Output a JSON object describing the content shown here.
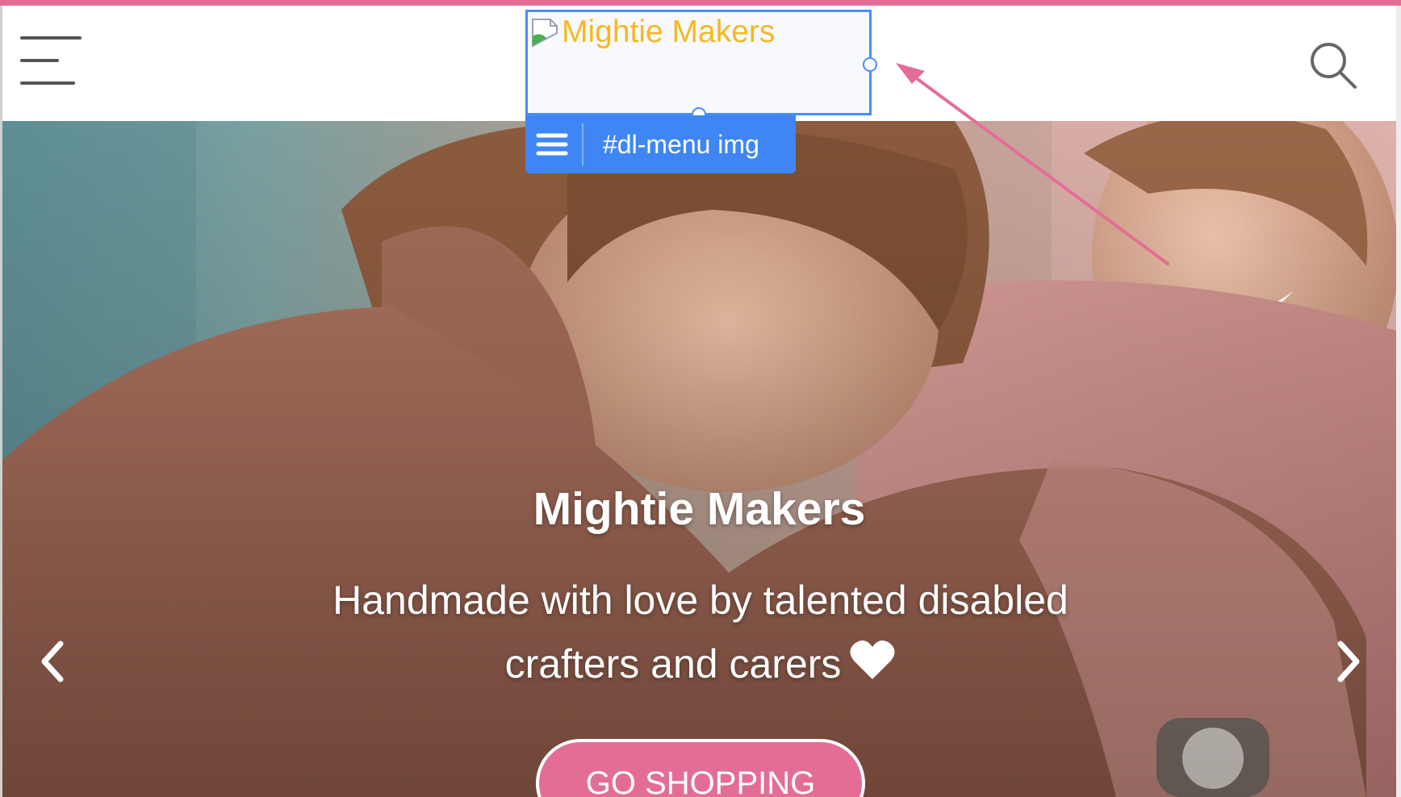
{
  "colors": {
    "accent_pink": "#e46d96",
    "selection_blue": "#4a8cf7",
    "tag_blue": "#3f86f4",
    "logo_alt_text": "#f5b820"
  },
  "header": {
    "menu_icon": "hamburger-icon",
    "search_icon": "search-icon",
    "logo_alt": "Mightie Makers",
    "broken_image_icon": "broken-image-icon"
  },
  "inspector": {
    "selector_label": "#dl-menu img",
    "menu_icon": "hamburger-icon"
  },
  "hero": {
    "title": "Mightie Makers",
    "subtitle": "Handmade with love by talented disabled crafters and carers",
    "heart_icon": "heart-icon",
    "prev_icon": "chevron-left-icon",
    "next_icon": "chevron-right-icon",
    "cta_label": "GO SHOPPING"
  }
}
